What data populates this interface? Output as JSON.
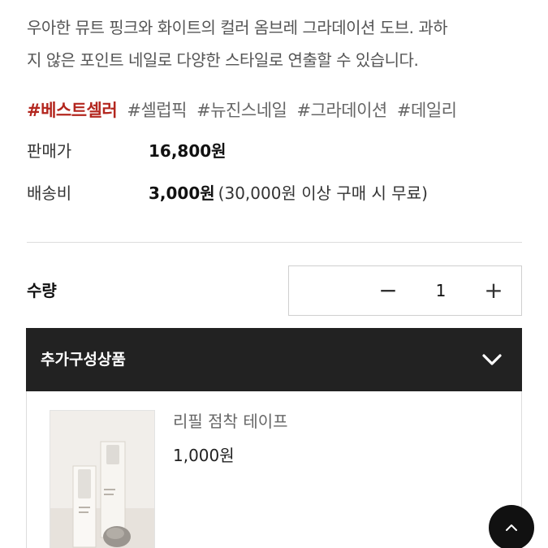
{
  "description": {
    "line1": "우아한 뮤트 핑크와 화이트의 컬러 옴브레 그라데이션 도브. 과하",
    "line2": "지 않은 포인트 네일로 다양한 스타일로 연출할 수 있습니다."
  },
  "tags": [
    {
      "text": "#베스트셀러",
      "highlight": true
    },
    {
      "text": "#셀럽픽",
      "highlight": false
    },
    {
      "text": "#뉴진스네일",
      "highlight": false
    },
    {
      "text": "#그라데이션",
      "highlight": false
    },
    {
      "text": "#데일리",
      "highlight": false
    }
  ],
  "price": {
    "label": "판매가",
    "value": "16,800원"
  },
  "shipping": {
    "label": "배송비",
    "value": "3,000원",
    "note": "(30,000원 이상 구매 시 무료)"
  },
  "quantity": {
    "label": "수량",
    "minus": "−",
    "value": "1",
    "plus": "+"
  },
  "addon": {
    "title": "추가구성상품",
    "product": {
      "name": "리필 점착 테이프",
      "price": "1,000원"
    }
  },
  "colors": {
    "accent": "#b3261e",
    "header_bg": "#222222"
  },
  "icons": {
    "addon_toggle": "chevron-down-icon",
    "scroll_top": "chevron-up-icon"
  }
}
